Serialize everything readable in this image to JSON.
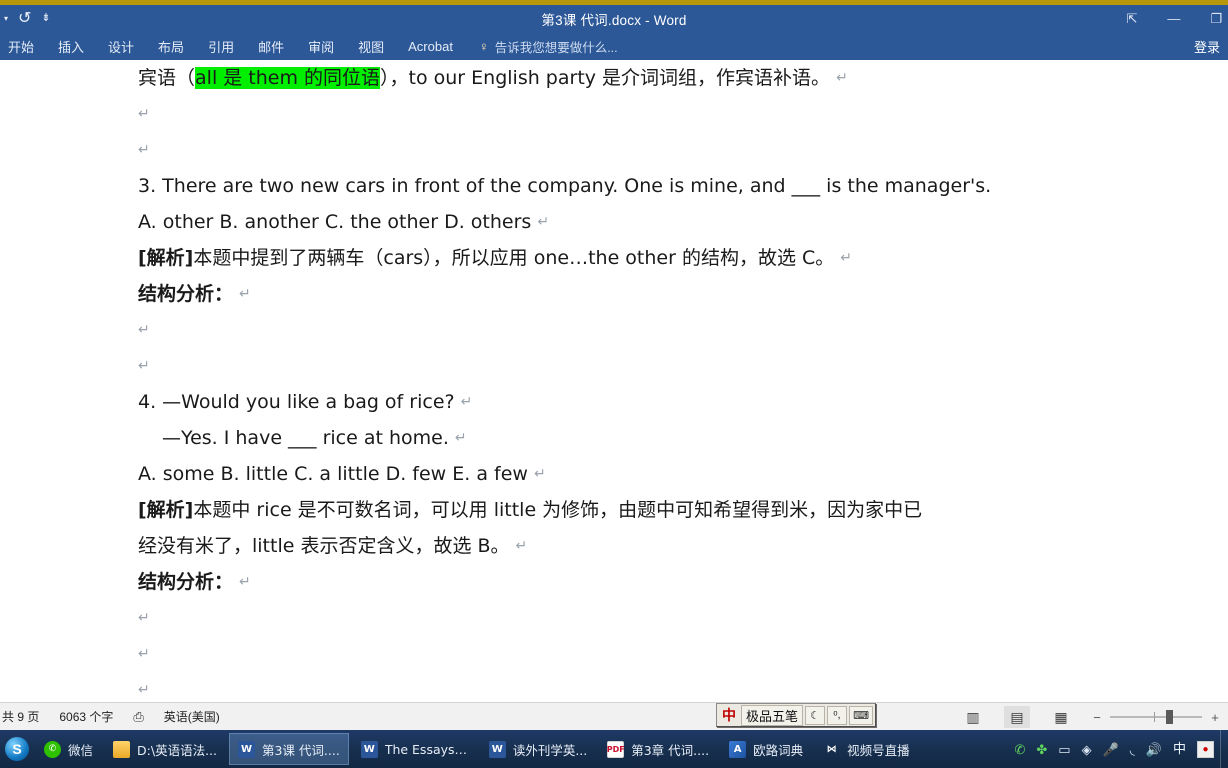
{
  "window": {
    "title": "第3课 代词.docx - Word",
    "quick_access": [
      {
        "name": "customize-qat",
        "glyph": "▾"
      },
      {
        "name": "undo",
        "glyph": "↺"
      },
      {
        "name": "qat-more",
        "glyph": "⇟"
      }
    ],
    "controls": [
      {
        "name": "ribbon-display-options",
        "glyph": "⇱"
      },
      {
        "name": "minimize",
        "glyph": "—"
      },
      {
        "name": "restore",
        "glyph": "❐"
      }
    ],
    "signin_label": "登录"
  },
  "ribbon": {
    "tabs": [
      "开始",
      "插入",
      "设计",
      "布局",
      "引用",
      "邮件",
      "审阅",
      "视图",
      "Acrobat"
    ],
    "tellme_placeholder": "告诉我您想要做什么...",
    "bulb_glyph": "♀"
  },
  "document": {
    "lines": [
      {
        "type": "text",
        "segments": [
          {
            "t": "宾语（",
            "style": "plain"
          },
          {
            "t": "all 是 them 的同位语",
            "style": "highlight"
          },
          {
            "t": "），to our English party 是介词词组，作宾语补语。",
            "style": "plain"
          }
        ],
        "pilcrow": true
      },
      {
        "type": "empty",
        "pilcrow": true
      },
      {
        "type": "empty",
        "pilcrow": true
      },
      {
        "type": "text",
        "segments": [
          {
            "t": "3. There are two new cars in front of the company. One is mine, and ___ is the manager's.",
            "style": "plain"
          }
        ],
        "pilcrow": false
      },
      {
        "type": "text",
        "segments": [
          {
            "t": "A. other      B. another      C. the other     D. others",
            "style": "plain"
          }
        ],
        "pilcrow": true
      },
      {
        "type": "text",
        "segments": [
          {
            "t": "[解析]",
            "style": "bold"
          },
          {
            "t": "本题中提到了两辆车（cars），所以应用 one…the other 的结构，故选 C。",
            "style": "plain"
          }
        ],
        "pilcrow": true
      },
      {
        "type": "text",
        "segments": [
          {
            "t": "结构分析：",
            "style": "bold"
          }
        ],
        "pilcrow": true
      },
      {
        "type": "empty",
        "pilcrow": true
      },
      {
        "type": "empty",
        "pilcrow": true
      },
      {
        "type": "text",
        "segments": [
          {
            "t": "4.  —Would you like a bag of rice?",
            "style": "plain"
          }
        ],
        "pilcrow": true
      },
      {
        "type": "text",
        "indent": true,
        "segments": [
          {
            "t": "—Yes. I have ___ rice at home.",
            "style": "plain"
          }
        ],
        "pilcrow": true
      },
      {
        "type": "text",
        "segments": [
          {
            "t": "A. some      B. little     C. a little      D. few      E. a few",
            "style": "plain"
          }
        ],
        "pilcrow": true
      },
      {
        "type": "text",
        "segments": [
          {
            "t": "[解析]",
            "style": "bold"
          },
          {
            "t": "本题中 rice 是不可数名词，可以用 little 为修饰，由题中可知希望得到米，因为家中已",
            "style": "plain"
          }
        ],
        "pilcrow": false
      },
      {
        "type": "text",
        "segments": [
          {
            "t": "经没有米了，little 表示否定含义，故选 B。",
            "style": "plain"
          }
        ],
        "pilcrow": true
      },
      {
        "type": "text",
        "segments": [
          {
            "t": "结构分析：",
            "style": "bold"
          }
        ],
        "pilcrow": true
      },
      {
        "type": "empty",
        "pilcrow": true
      },
      {
        "type": "empty",
        "pilcrow": true
      },
      {
        "type": "empty",
        "pilcrow": true
      }
    ],
    "highlight_color": "#00ef00"
  },
  "statusbar": {
    "page_info": "共 9 页",
    "word_count": "6063 个字",
    "proofing_icon": "⎙",
    "language": "英语(美国)",
    "views": [
      {
        "name": "read-mode",
        "glyph": "▥"
      },
      {
        "name": "print-layout",
        "glyph": "▤",
        "active": true
      },
      {
        "name": "web-layout",
        "glyph": "▦"
      }
    ],
    "zoom_minus": "−",
    "zoom_plus": "+"
  },
  "ime": {
    "mode": "中",
    "name": "极品五笔",
    "buttons": [
      {
        "name": "ime-moon-toggle",
        "glyph": "☾"
      },
      {
        "name": "ime-punctuation-toggle",
        "glyph": "ᵒ,"
      },
      {
        "name": "ime-soft-keyboard",
        "glyph": "⌨"
      }
    ]
  },
  "taskbar": {
    "start_glyph": "S",
    "tasks": [
      {
        "name": "taskbar-item-wechat",
        "label": "微信",
        "icon": "wechat",
        "glyph": "✆",
        "active": false
      },
      {
        "name": "taskbar-item-folder",
        "label": "D:\\英语语法...",
        "icon": "folder",
        "glyph": "",
        "active": false
      },
      {
        "name": "taskbar-item-word-daici",
        "label": "第3课 代词....",
        "icon": "word",
        "glyph": "W",
        "active": true
      },
      {
        "name": "taskbar-item-word-essays",
        "label": "The Essays ...",
        "icon": "word",
        "glyph": "W",
        "active": false
      },
      {
        "name": "taskbar-item-word-duwai",
        "label": "读外刊学英...",
        "icon": "word",
        "glyph": "W",
        "active": false
      },
      {
        "name": "taskbar-item-pdf-chapter3",
        "label": "第3章 代词....",
        "icon": "pdf",
        "glyph": "PDF",
        "active": false
      },
      {
        "name": "taskbar-item-eudic",
        "label": "欧路词典",
        "icon": "dict",
        "glyph": "A",
        "active": false
      },
      {
        "name": "taskbar-item-channels-live",
        "label": "视频号直播",
        "icon": "wx",
        "glyph": "⋈",
        "active": false
      }
    ],
    "tray": [
      {
        "name": "tray-wechat-icon",
        "glyph": "✆",
        "cls": "green"
      },
      {
        "name": "tray-app-icon",
        "glyph": "✤",
        "cls": "green"
      },
      {
        "name": "tray-battery-icon",
        "glyph": "▭",
        "cls": ""
      },
      {
        "name": "tray-security-icon",
        "glyph": "◈",
        "cls": ""
      },
      {
        "name": "tray-microphone-icon",
        "glyph": "🎤",
        "cls": ""
      },
      {
        "name": "tray-wifi-icon",
        "glyph": "◟",
        "cls": ""
      },
      {
        "name": "tray-volume-icon",
        "glyph": "🔊",
        "cls": ""
      },
      {
        "name": "tray-ime-indicator",
        "glyph": "中",
        "cls": "ime"
      }
    ]
  }
}
